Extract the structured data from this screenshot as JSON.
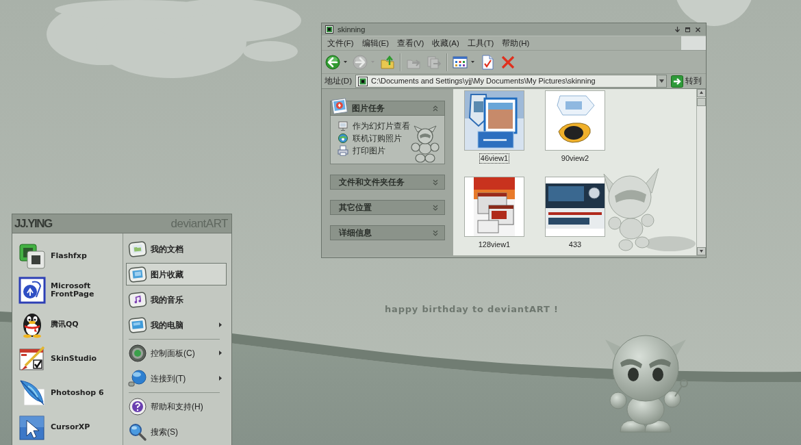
{
  "desktop": {
    "caption": "happy birthday to deviantART !"
  },
  "explorer": {
    "title": "skinning",
    "menu": [
      "文件(F)",
      "编辑(E)",
      "查看(V)",
      "收藏(A)",
      "工具(T)",
      "帮助(H)"
    ],
    "toolbar": [
      {
        "kind": "back",
        "disabled": false,
        "dropdown": true
      },
      {
        "kind": "forward",
        "disabled": true,
        "dropdown": true
      },
      {
        "kind": "up",
        "disabled": false,
        "dropdown": false
      },
      {
        "kind": "separator"
      },
      {
        "kind": "move",
        "disabled": true,
        "dropdown": false
      },
      {
        "kind": "copy",
        "disabled": true,
        "dropdown": false
      },
      {
        "kind": "separator"
      },
      {
        "kind": "views",
        "disabled": false,
        "dropdown": true
      },
      {
        "kind": "properties",
        "disabled": false,
        "dropdown": false
      },
      {
        "kind": "delete",
        "disabled": false,
        "dropdown": false
      }
    ],
    "address": {
      "label": "地址(D)",
      "value": "C:\\Documents and Settings\\yjj\\My Documents\\My Pictures\\skinning",
      "go": "转到"
    },
    "task_panes": [
      {
        "kind": "special",
        "title": "图片任务",
        "expanded": true,
        "items": [
          {
            "kind": "slideshow",
            "label": "作为幻灯片查看"
          },
          {
            "kind": "order",
            "label": "联机订购照片"
          },
          {
            "kind": "print",
            "label": "打印图片"
          }
        ]
      },
      {
        "kind": "normal",
        "title": "文件和文件夹任务",
        "expanded": false
      },
      {
        "kind": "normal",
        "title": "其它位置",
        "expanded": false
      },
      {
        "kind": "normal",
        "title": "详细信息",
        "expanded": false
      }
    ],
    "thumbnails": [
      {
        "kind": "poster",
        "label": "46view1",
        "selected": true
      },
      {
        "kind": "gadget",
        "label": "90view2",
        "selected": false
      },
      {
        "kind": "windows",
        "label": "128view1",
        "selected": false
      },
      {
        "kind": "portal",
        "label": "433",
        "selected": false
      }
    ]
  },
  "start_menu": {
    "user": "JJ.YING",
    "brand": "deviantART",
    "programs": [
      {
        "kind": "squares",
        "label": "Flashfxp"
      },
      {
        "kind": "pagecircle",
        "label": "Microsoft FrontPage"
      },
      {
        "kind": "penguin",
        "label": "腾讯QQ"
      },
      {
        "kind": "brush",
        "label": "SkinStudio"
      },
      {
        "kind": "feather",
        "label": "Photoshop 6"
      },
      {
        "kind": "cursor",
        "label": "CursorXP"
      }
    ],
    "places": [
      {
        "kind": "documents",
        "label": "我的文档",
        "selected": false,
        "submenu": false
      },
      {
        "kind": "pictures",
        "label": "图片收藏",
        "selected": true,
        "submenu": false
      },
      {
        "kind": "music",
        "label": "我的音乐",
        "selected": false,
        "submenu": false
      },
      {
        "kind": "computer",
        "label": "我的电脑",
        "selected": false,
        "submenu": true
      },
      {
        "kind": "separator"
      },
      {
        "kind": "control",
        "label": "控制面板(C)",
        "selected": false,
        "submenu": true
      },
      {
        "kind": "connect",
        "label": "连接到(T)",
        "selected": false,
        "submenu": true
      },
      {
        "kind": "separator"
      },
      {
        "kind": "help",
        "label": "帮助和支持(H)",
        "selected": false,
        "submenu": false
      },
      {
        "kind": "search",
        "label": "搜索(S)",
        "selected": false,
        "submenu": false
      }
    ]
  }
}
